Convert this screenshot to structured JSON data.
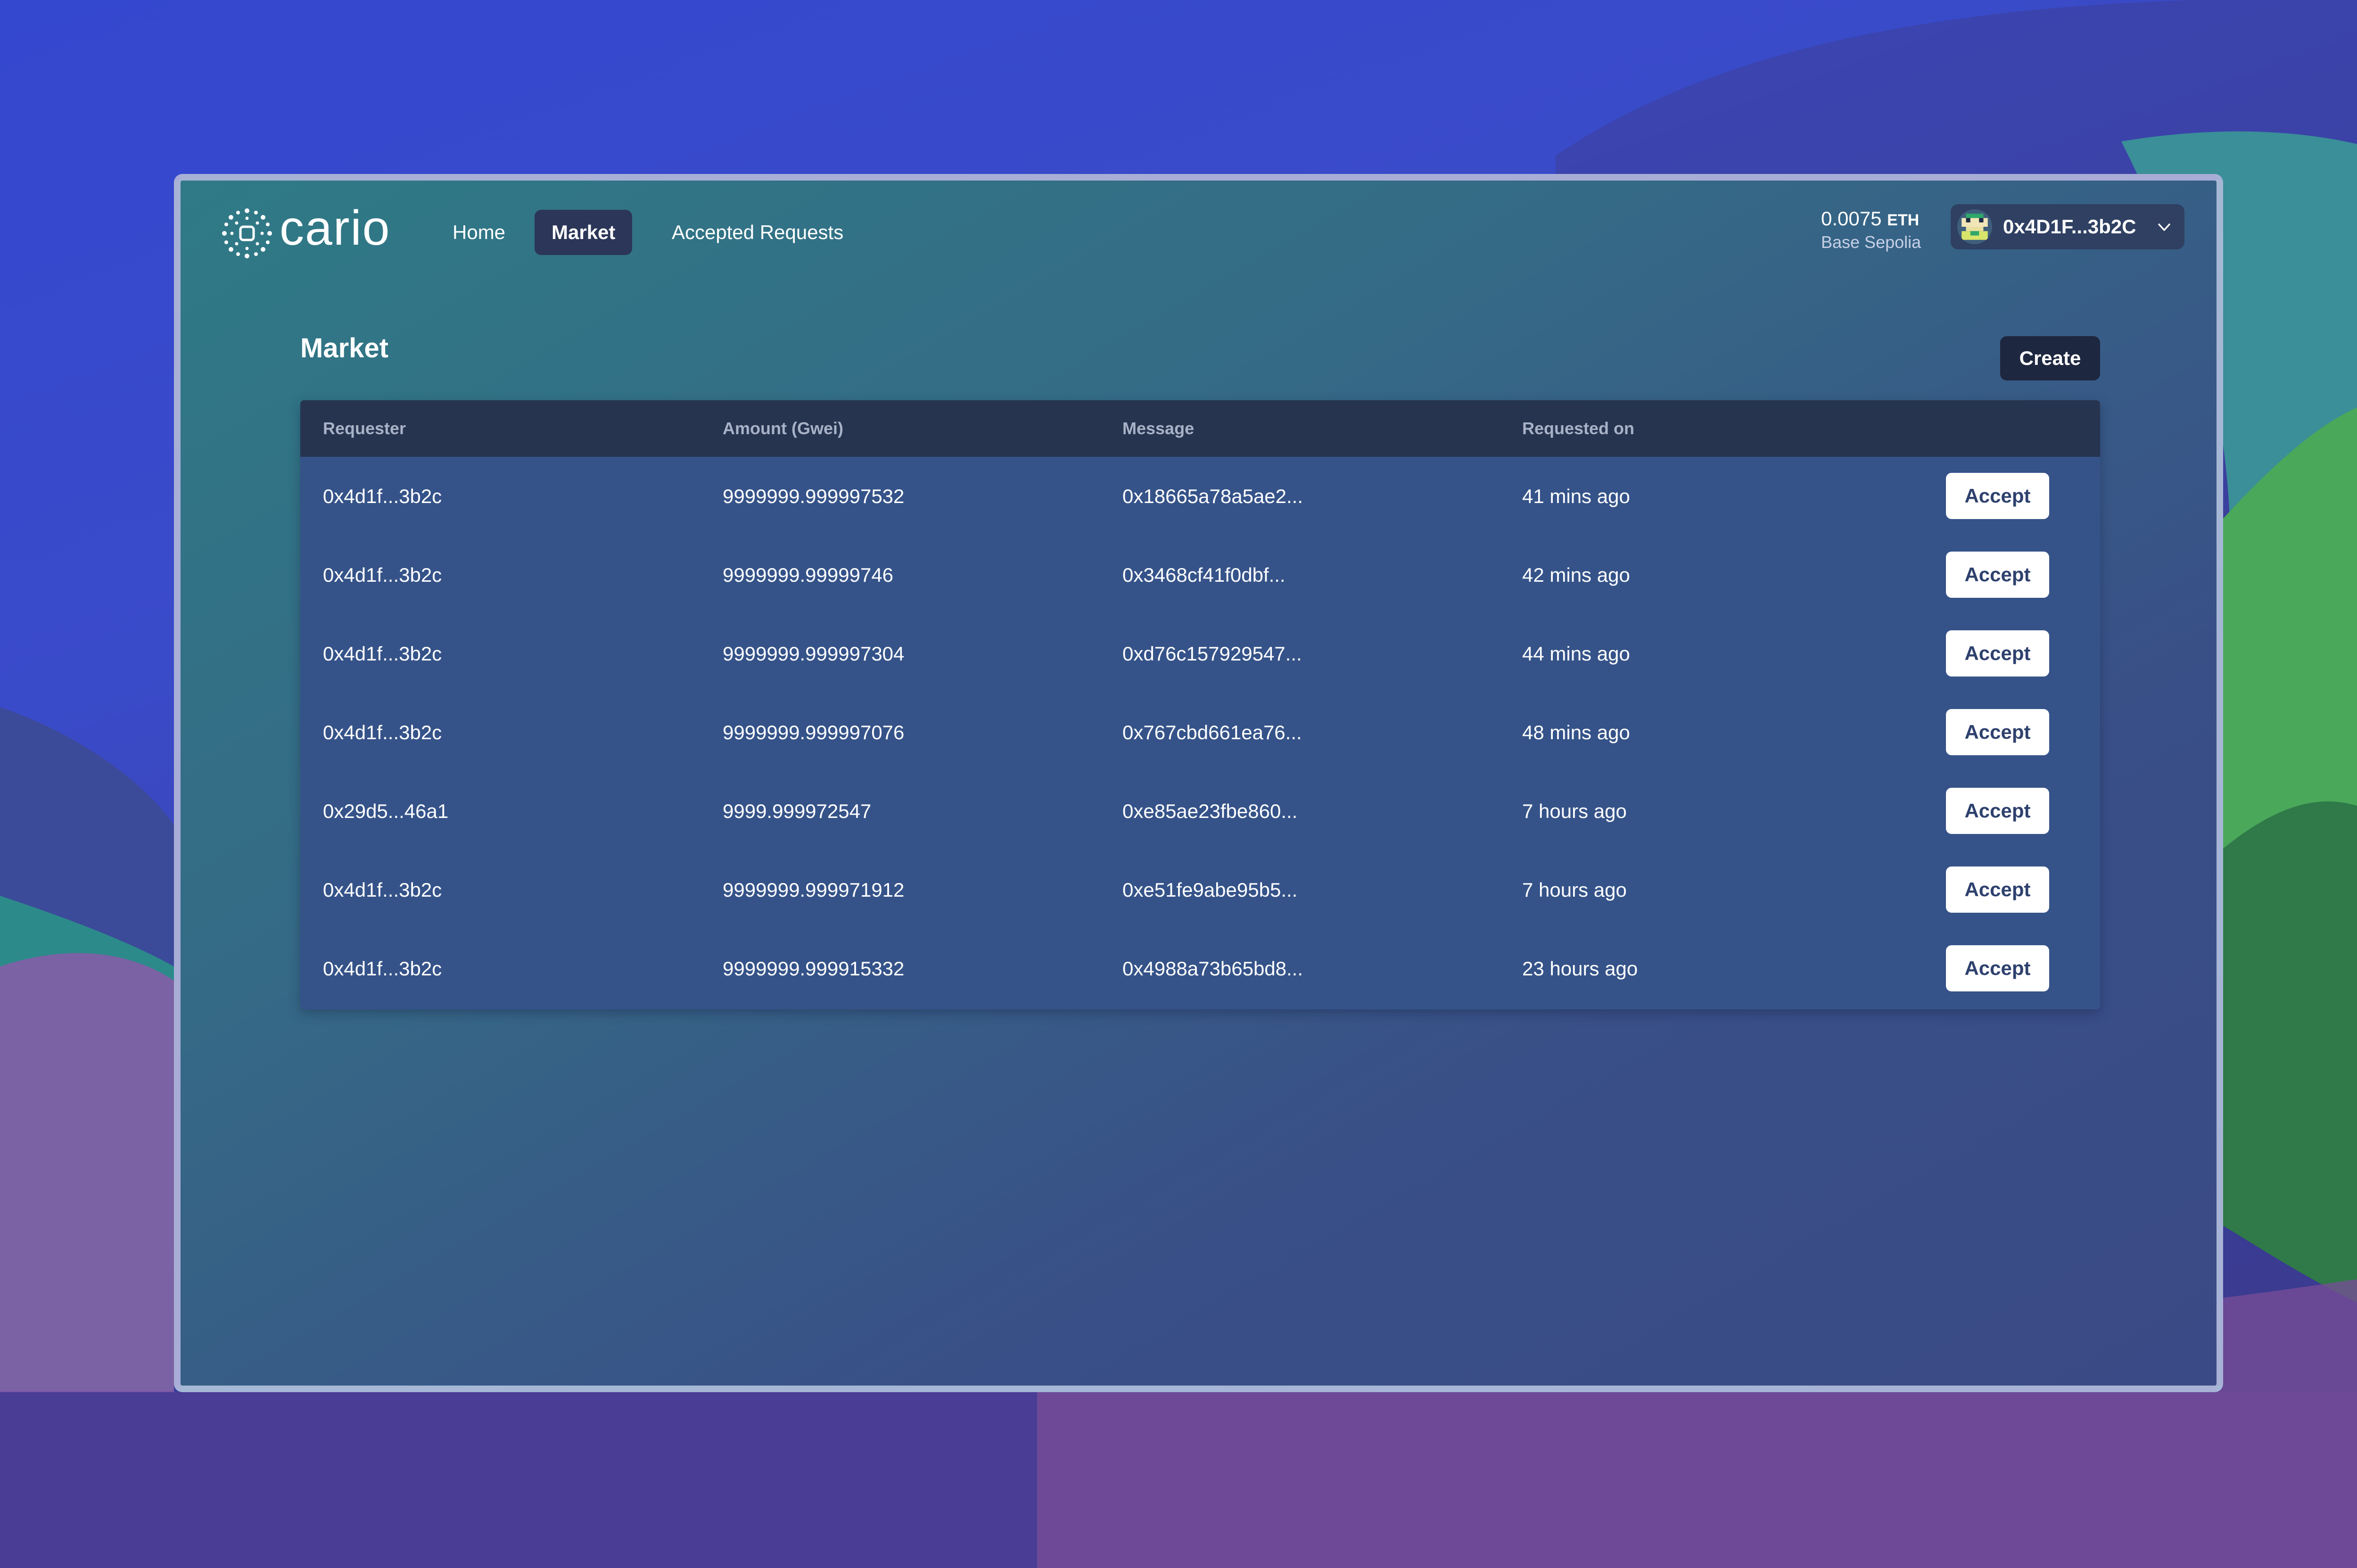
{
  "header": {
    "brand": "cario",
    "nav": [
      {
        "label": "Home"
      },
      {
        "label": "Market",
        "active": true
      },
      {
        "label": "Accepted Requests"
      }
    ],
    "balance": {
      "amount": "0.0075",
      "unit": "ETH",
      "network": "Base Sepolia"
    },
    "account": {
      "address": "0x4D1F...3b2C",
      "avatar_icon": "pixel-avatar-icon"
    }
  },
  "main": {
    "title": "Market",
    "create_label": "Create",
    "table": {
      "columns": [
        "Requester",
        "Amount (Gwei)",
        "Message",
        "Requested on",
        ""
      ],
      "rows": [
        {
          "requester": "0x4d1f...3b2c",
          "amount": "9999999.999997532",
          "message": "0x18665a78a5ae2...",
          "requested_on": "41 mins ago",
          "action": "Accept"
        },
        {
          "requester": "0x4d1f...3b2c",
          "amount": "9999999.99999746",
          "message": "0x3468cf41f0dbf...",
          "requested_on": "42 mins ago",
          "action": "Accept"
        },
        {
          "requester": "0x4d1f...3b2c",
          "amount": "9999999.999997304",
          "message": "0xd76c157929547...",
          "requested_on": "44 mins ago",
          "action": "Accept"
        },
        {
          "requester": "0x4d1f...3b2c",
          "amount": "9999999.999997076",
          "message": "0x767cbd661ea76...",
          "requested_on": "48 mins ago",
          "action": "Accept"
        },
        {
          "requester": "0x29d5...46a1",
          "amount": "9999.999972547",
          "message": "0xe85ae23fbe860...",
          "requested_on": "7 hours ago",
          "action": "Accept"
        },
        {
          "requester": "0x4d1f...3b2c",
          "amount": "9999999.999971912",
          "message": "0xe51fe9abe95b5...",
          "requested_on": "7 hours ago",
          "action": "Accept"
        },
        {
          "requester": "0x4d1f...3b2c",
          "amount": "9999999.999915332",
          "message": "0x4988a73b65bd8...",
          "requested_on": "23 hours ago",
          "action": "Accept"
        }
      ]
    }
  },
  "colors": {
    "accent_dark": "#1e2740",
    "table_bg": "#355389",
    "table_header_bg": "#27344f",
    "nav_active_bg": "#2b3658"
  }
}
